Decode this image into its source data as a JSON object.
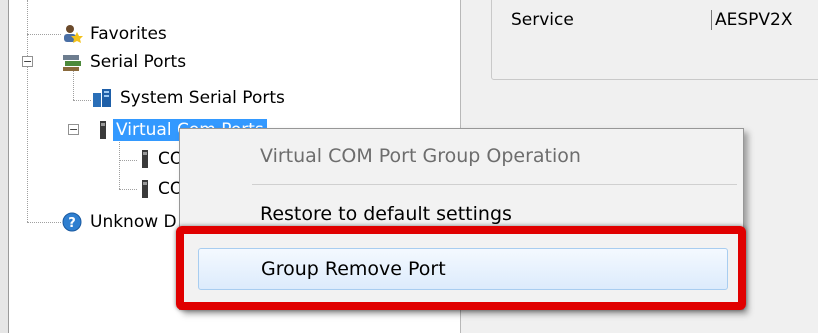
{
  "tree": {
    "items": [
      {
        "label": "Favorites",
        "icon": "favorites-icon"
      },
      {
        "label": "Serial Ports",
        "icon": "serial-ports-icon",
        "expander": "−"
      },
      {
        "label": "System Serial Ports",
        "icon": "system-ports-icon"
      },
      {
        "label": "Virtual Com Ports",
        "icon": "virtual-port-icon",
        "expander": "−",
        "selected": true
      },
      {
        "label": "CO",
        "icon": "port-icon"
      },
      {
        "label": "CO",
        "icon": "port-icon"
      },
      {
        "label": "Unknow D",
        "icon": "help-icon"
      }
    ]
  },
  "properties": {
    "name": "Service",
    "value": "AESPV2X"
  },
  "context_menu": {
    "header": "Virtual COM Port Group Operation",
    "items": [
      "Restore to default settings",
      "Group Remove Port"
    ]
  },
  "colors": {
    "selection": "#3399ff",
    "annotation_highlight": "#e00000"
  }
}
